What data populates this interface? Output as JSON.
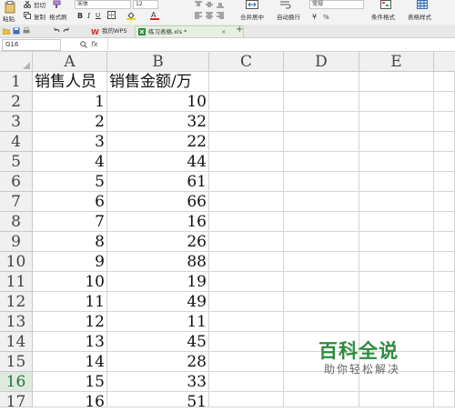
{
  "ribbon": {
    "paste_label": "粘贴",
    "cut_label": "剪切",
    "copy_label": "复制",
    "format_painter_label": "格式刷",
    "font_name": "宋体",
    "font_size": "12",
    "merge_center_label": "合并居中",
    "wrap_text_label": "自动换行",
    "number_format": "常规",
    "conditional_format_label": "条件格式",
    "table_style_label": "表格样式"
  },
  "tabs": [
    {
      "label": "我的WPS"
    },
    {
      "label": "练习表格.xls *"
    }
  ],
  "formula_bar": {
    "name_box": "G16",
    "fx_label": "fx"
  },
  "columns": [
    "A",
    "B",
    "C",
    "D",
    "E"
  ],
  "rows": [
    {
      "n": "1",
      "a": "销售人员",
      "b": "销售金额/万"
    },
    {
      "n": "2",
      "a": "1",
      "b": "10"
    },
    {
      "n": "3",
      "a": "2",
      "b": "32"
    },
    {
      "n": "4",
      "a": "3",
      "b": "22"
    },
    {
      "n": "5",
      "a": "4",
      "b": "44"
    },
    {
      "n": "6",
      "a": "5",
      "b": "61"
    },
    {
      "n": "7",
      "a": "6",
      "b": "66"
    },
    {
      "n": "8",
      "a": "7",
      "b": "16"
    },
    {
      "n": "9",
      "a": "8",
      "b": "26"
    },
    {
      "n": "10",
      "a": "9",
      "b": "88"
    },
    {
      "n": "11",
      "a": "10",
      "b": "19"
    },
    {
      "n": "12",
      "a": "11",
      "b": "49"
    },
    {
      "n": "13",
      "a": "12",
      "b": "11"
    },
    {
      "n": "14",
      "a": "13",
      "b": "45"
    },
    {
      "n": "15",
      "a": "14",
      "b": "28"
    },
    {
      "n": "16",
      "a": "15",
      "b": "33"
    },
    {
      "n": "17",
      "a": "16",
      "b": "51"
    }
  ],
  "selected_row": "16",
  "watermark": {
    "title": "百科全说",
    "subtitle": "助你轻松解决"
  },
  "colors": {
    "accent_green": "#217346",
    "watermark_green": "#2e8b3e"
  }
}
